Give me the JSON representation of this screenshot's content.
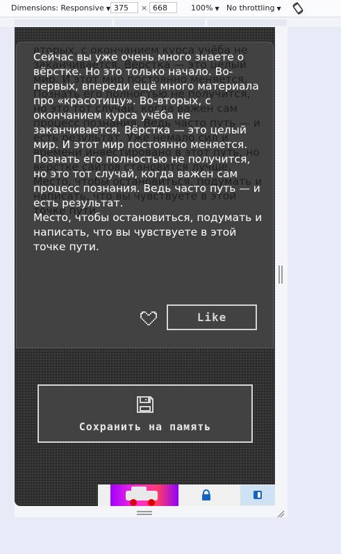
{
  "devtools": {
    "dimensions_label": "Dimensions: Responsive",
    "width_value": "375",
    "times": "×",
    "height_value": "668",
    "zoom": "100%",
    "throttling": "No throttling"
  },
  "card": {
    "ghost_text": "материала про «красотищу». Во-вторых, с окончанием курса учёба не заканчивается. Вёрстка — это целый мир. И этот мир постоянно меняется. Познать его полностью не получится, но это тот случай, когда важен сам процесс познания. Ведь часто путь — и есть результат. Уже немало сил и времени инвестировано в этот путь, но вёрстке сайтов становится лучше. Место, чтобы остановиться, подумать и написать, что вы чувствуете в этой точке пути.",
    "main_text": "Сейчас вы уже очень много знаете о вёрстке. Но это только начало. Во-первых, впереди ещё много материала про «красотищу». Во-вторых, с окончанием курса учёба не заканчивается. Вёрстка — это целый мир. И этот мир постоянно меняется. Познать его полностью не получится, но это тот случай, когда важен сам процесс познания. Ведь часто путь — и есть результат.",
    "main_text_2": "Место, чтобы остановиться, подумать и написать, что вы чувствуете в этой точке пути.",
    "like_label": "Like"
  },
  "save": {
    "label": "Сохранить на память"
  },
  "colors": {
    "background": "#2d2d2d",
    "card": "#424242",
    "button_border": "#d6d6d6",
    "text": "#ffffff"
  },
  "icons": {
    "heart": "heart-icon",
    "save": "save-icon",
    "lock": "lock-icon",
    "rotate": "rotate-icon"
  }
}
